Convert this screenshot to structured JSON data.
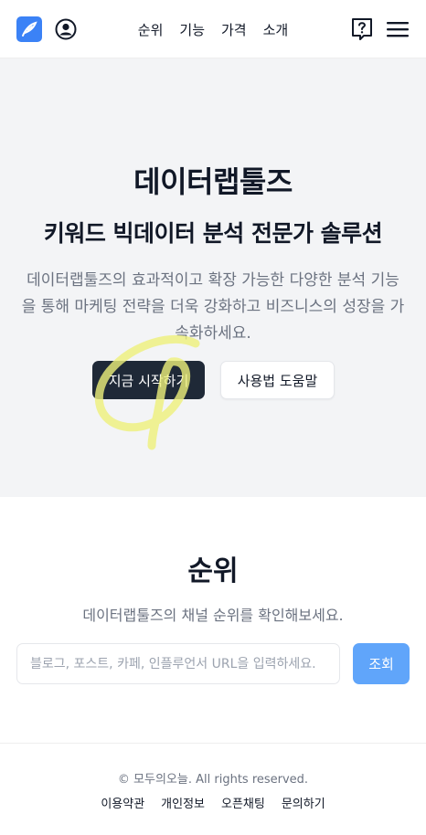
{
  "header": {
    "logo_icon": "feather-logo-icon",
    "user_icon": "user-circle-icon",
    "nav": [
      "순위",
      "기능",
      "가격",
      "소개"
    ],
    "help_icon": "question-bubble-icon",
    "menu_icon": "hamburger-menu-icon"
  },
  "hero": {
    "title": "데이터랩툴즈",
    "subtitle": "키워드 빅데이터 분석 전문가 솔루션",
    "description": "데이터랩툴즈의 효과적이고 확장 가능한 다양한 분석 기능을 통해 마케팅 전략을 더욱 강화하고 비즈니스의 성장을 가속화하세요.",
    "start_button": "지금 시작하기",
    "help_button": "사용법 도움말"
  },
  "ranking": {
    "title": "순위",
    "description": "데이터랩툴즈의 채널 순위를 확인해보세요.",
    "input_placeholder": "블로그, 포스트, 카페, 인플루언서 URL을 입력하세요.",
    "search_button": "조회"
  },
  "footer": {
    "copyright": "© 모두의오늘. All rights reserved.",
    "links": [
      "이용약관",
      "개인정보",
      "오픈채팅",
      "문의하기"
    ]
  },
  "colors": {
    "brand": "#3b82f6",
    "dark_button": "#1f2937",
    "search_button": "#60a5fa",
    "hero_bg": "#f3f4f6",
    "scribble": "#eef07a"
  }
}
